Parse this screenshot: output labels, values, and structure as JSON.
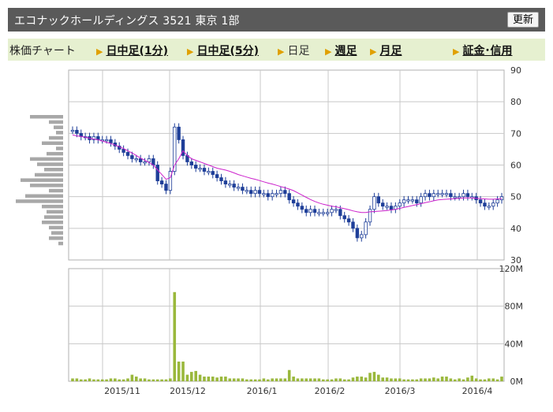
{
  "header": {
    "title": "エコナックホールディングス  3521  東京 1部",
    "refresh_label": "更新"
  },
  "nav": {
    "label": "株価チャート",
    "items": [
      {
        "label": "日中足(1分)",
        "current": false
      },
      {
        "label": "日中足(5分)",
        "current": false
      },
      {
        "label": "日足",
        "current": true
      },
      {
        "label": "週足",
        "current": false
      },
      {
        "label": "月足",
        "current": false
      },
      {
        "label": "証金･信用",
        "current": false
      }
    ]
  },
  "colors": {
    "up": "#ffffff",
    "down": "#1f3f99",
    "ma": "#cc22cc",
    "volume": "#9ab83c",
    "profile": "#a8a8a8",
    "grid": "#c8c8c8"
  },
  "chart_data": [
    {
      "type": "candlestick",
      "y_ticks": [
        30,
        40,
        50,
        60,
        70,
        80,
        90
      ],
      "ylim": [
        30,
        90
      ],
      "x_ticks": [
        "2015/11",
        "2015/12",
        "2016/1",
        "2016/2",
        "2016/3",
        "2016/4"
      ],
      "price": [
        71,
        70,
        69,
        69,
        68,
        69,
        68,
        68,
        68,
        67,
        66,
        65,
        64,
        63,
        62,
        62,
        61,
        61,
        62,
        60,
        55,
        54,
        52,
        58,
        72,
        68,
        63,
        61,
        60,
        59,
        59,
        58,
        58,
        57,
        56,
        55,
        54,
        54,
        53,
        53,
        52,
        52,
        51,
        52,
        51,
        51,
        50,
        51,
        51,
        52,
        51,
        49,
        48,
        47,
        46,
        45,
        46,
        45,
        45,
        45,
        45,
        46,
        46,
        44,
        43,
        42,
        40,
        37,
        38,
        42,
        46,
        50,
        48,
        47,
        47,
        46,
        47,
        48,
        49,
        49,
        49,
        48,
        50,
        51,
        50,
        51,
        51,
        51,
        51,
        50,
        50,
        50,
        51,
        50,
        50,
        49,
        48,
        47,
        47,
        48,
        49,
        50
      ],
      "ma": [
        69.5,
        69.2,
        69,
        68.8,
        68.5,
        68.2,
        68,
        67.6,
        67.2,
        66.8,
        66.3,
        65.8,
        65.2,
        64.5,
        63.8,
        63,
        62.2,
        61.5,
        60.8,
        60,
        58.5,
        57,
        55.5,
        56,
        60,
        62,
        64.5,
        63,
        62,
        61.5,
        61,
        60.5,
        60,
        59.5,
        59,
        58.7,
        58.4,
        58,
        57.5,
        57,
        56.6,
        56.2,
        55.8,
        55.5,
        55.1,
        54.7,
        54.3,
        54,
        53.6,
        53.2,
        52.8,
        52.4,
        51.9,
        51.2,
        50.5,
        49.8,
        49.1,
        48.5,
        48,
        47.6,
        47.3,
        47,
        46.8,
        46.5,
        46.2,
        45.9,
        45.5,
        45.2,
        45,
        45,
        45.2,
        45.3,
        45.4,
        45.5,
        45.6,
        45.8,
        46,
        46.3,
        46.6,
        46.9,
        47.2,
        47.5,
        47.8,
        48.1,
        48.4,
        48.7,
        49,
        49.1,
        49.2,
        49.3,
        49.4,
        49.5,
        49.6,
        49.6,
        49.6,
        49.5,
        49.4,
        49.3,
        49.2,
        49.2,
        49.3,
        49.4
      ],
      "volume_profile": [
        14,
        6,
        4,
        3,
        6,
        9,
        3,
        7,
        14,
        11,
        8,
        12,
        18,
        14,
        6,
        16,
        20,
        9,
        7,
        8,
        9,
        6,
        5,
        6,
        2
      ]
    },
    {
      "type": "bar",
      "y_ticks": [
        "0M",
        "40M",
        "80M",
        "120M"
      ],
      "ylim": [
        0,
        120
      ],
      "values": [
        3,
        3,
        2,
        2,
        3,
        2,
        2,
        2,
        2,
        3,
        3,
        2,
        2,
        3,
        7,
        5,
        3,
        3,
        2,
        2,
        2,
        2,
        2,
        3,
        95,
        21,
        21,
        7,
        10,
        11,
        7,
        5,
        5,
        5,
        4,
        5,
        5,
        3,
        3,
        3,
        3,
        2,
        2,
        2,
        2,
        3,
        2,
        3,
        3,
        3,
        3,
        12,
        5,
        3,
        3,
        3,
        3,
        3,
        3,
        2,
        2,
        2,
        3,
        3,
        2,
        2,
        4,
        5,
        5,
        4,
        9,
        10,
        7,
        4,
        4,
        3,
        3,
        3,
        2,
        2,
        2,
        2,
        3,
        3,
        3,
        4,
        3,
        5,
        5,
        3,
        2,
        3,
        2,
        4,
        6,
        3,
        2,
        2,
        3,
        3,
        2,
        5
      ]
    }
  ]
}
